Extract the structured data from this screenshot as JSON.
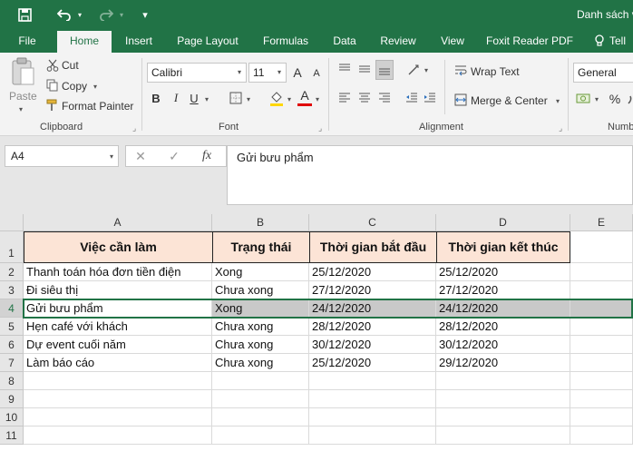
{
  "window": {
    "title": "Danh sách v"
  },
  "tabs": [
    "File",
    "Home",
    "Insert",
    "Page Layout",
    "Formulas",
    "Data",
    "Review",
    "View",
    "Foxit Reader PDF",
    "Tell"
  ],
  "ribbon": {
    "clipboard": {
      "paste": "Paste",
      "cut": "Cut",
      "copy": "Copy",
      "format_painter": "Format Painter",
      "label": "Clipboard"
    },
    "font": {
      "name": "Calibri",
      "size": "11",
      "bold": "B",
      "italic": "I",
      "underline": "U",
      "grow": "A",
      "shrink": "A",
      "color_glyph": "A",
      "label": "Font"
    },
    "alignment": {
      "wrap_text": "Wrap Text",
      "merge_center": "Merge & Center",
      "label": "Alignment"
    },
    "number": {
      "format": "General",
      "percent": "%",
      "label": "Numb"
    }
  },
  "formula_bar": {
    "name_box": "A4",
    "cancel": "✕",
    "enter": "✓",
    "fx": "fx",
    "content": "Gửi bưu phẩm"
  },
  "sheet": {
    "columns": [
      "A",
      "B",
      "C",
      "D",
      "E"
    ],
    "row_numbers": [
      "1",
      "2",
      "3",
      "4",
      "5",
      "6",
      "7",
      "8",
      "9",
      "10",
      "11"
    ],
    "header": [
      "Việc cần làm",
      "Trạng thái",
      "Thời gian bắt đầu",
      "Thời gian kết thúc"
    ],
    "rows": [
      [
        "Thanh toán hóa đơn tiền điện",
        "Xong",
        "25/12/2020",
        "25/12/2020"
      ],
      [
        "Đi siêu thị",
        "Chưa xong",
        "27/12/2020",
        "27/12/2020"
      ],
      [
        "Gửi bưu phẩm",
        "Xong",
        "24/12/2020",
        "24/12/2020"
      ],
      [
        "Hẹn café với khách",
        "Chưa xong",
        "28/12/2020",
        "28/12/2020"
      ],
      [
        "Dự event cuối năm",
        "Chưa xong",
        "30/12/2020",
        "30/12/2020"
      ],
      [
        "Làm báo cáo",
        "Chưa xong",
        "25/12/2020",
        "29/12/2020"
      ]
    ],
    "selected_row": 4,
    "colors": {
      "accent": "#217346",
      "header_fill": "#fce4d6",
      "selection_fill": "#c9c9c9"
    }
  }
}
